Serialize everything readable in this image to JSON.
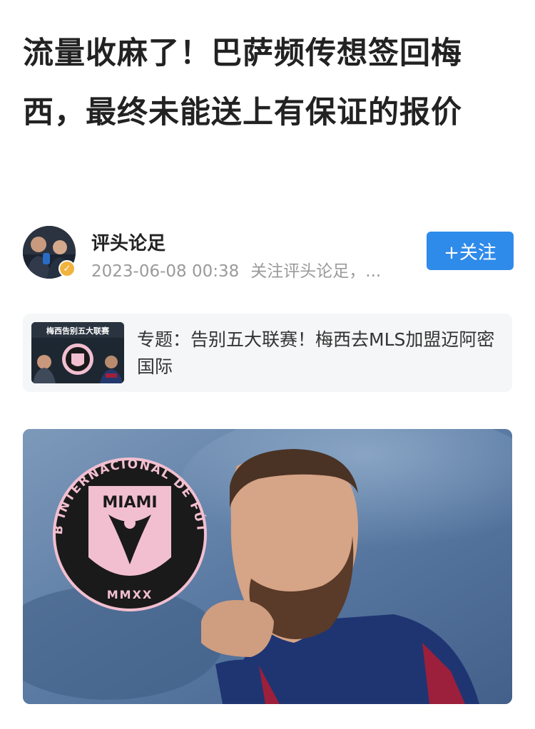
{
  "article": {
    "title": "流量收麻了！巴萨频传想签回梅西，最终未能送上有保证的报价"
  },
  "author": {
    "name": "评头论足",
    "date": "2023-06-08 00:38",
    "meta_text": "关注评头论足，...",
    "follow_label": "+关注",
    "verified_icon": "verified-badge-icon"
  },
  "topic": {
    "text": "专题：告别五大联赛！梅西去MLS加盟迈阿密国际",
    "thumb_banner": "梅西告别五大联赛"
  },
  "hero": {
    "badge_top_text": "CLUB INTERNACIONAL DE FÚTBOL",
    "badge_name": "MIAMI",
    "badge_year": "MMXX"
  },
  "colors": {
    "follow_button": "#2f8bea",
    "badge_pink": "#f2bfd0",
    "verified": "#f2b33d"
  }
}
